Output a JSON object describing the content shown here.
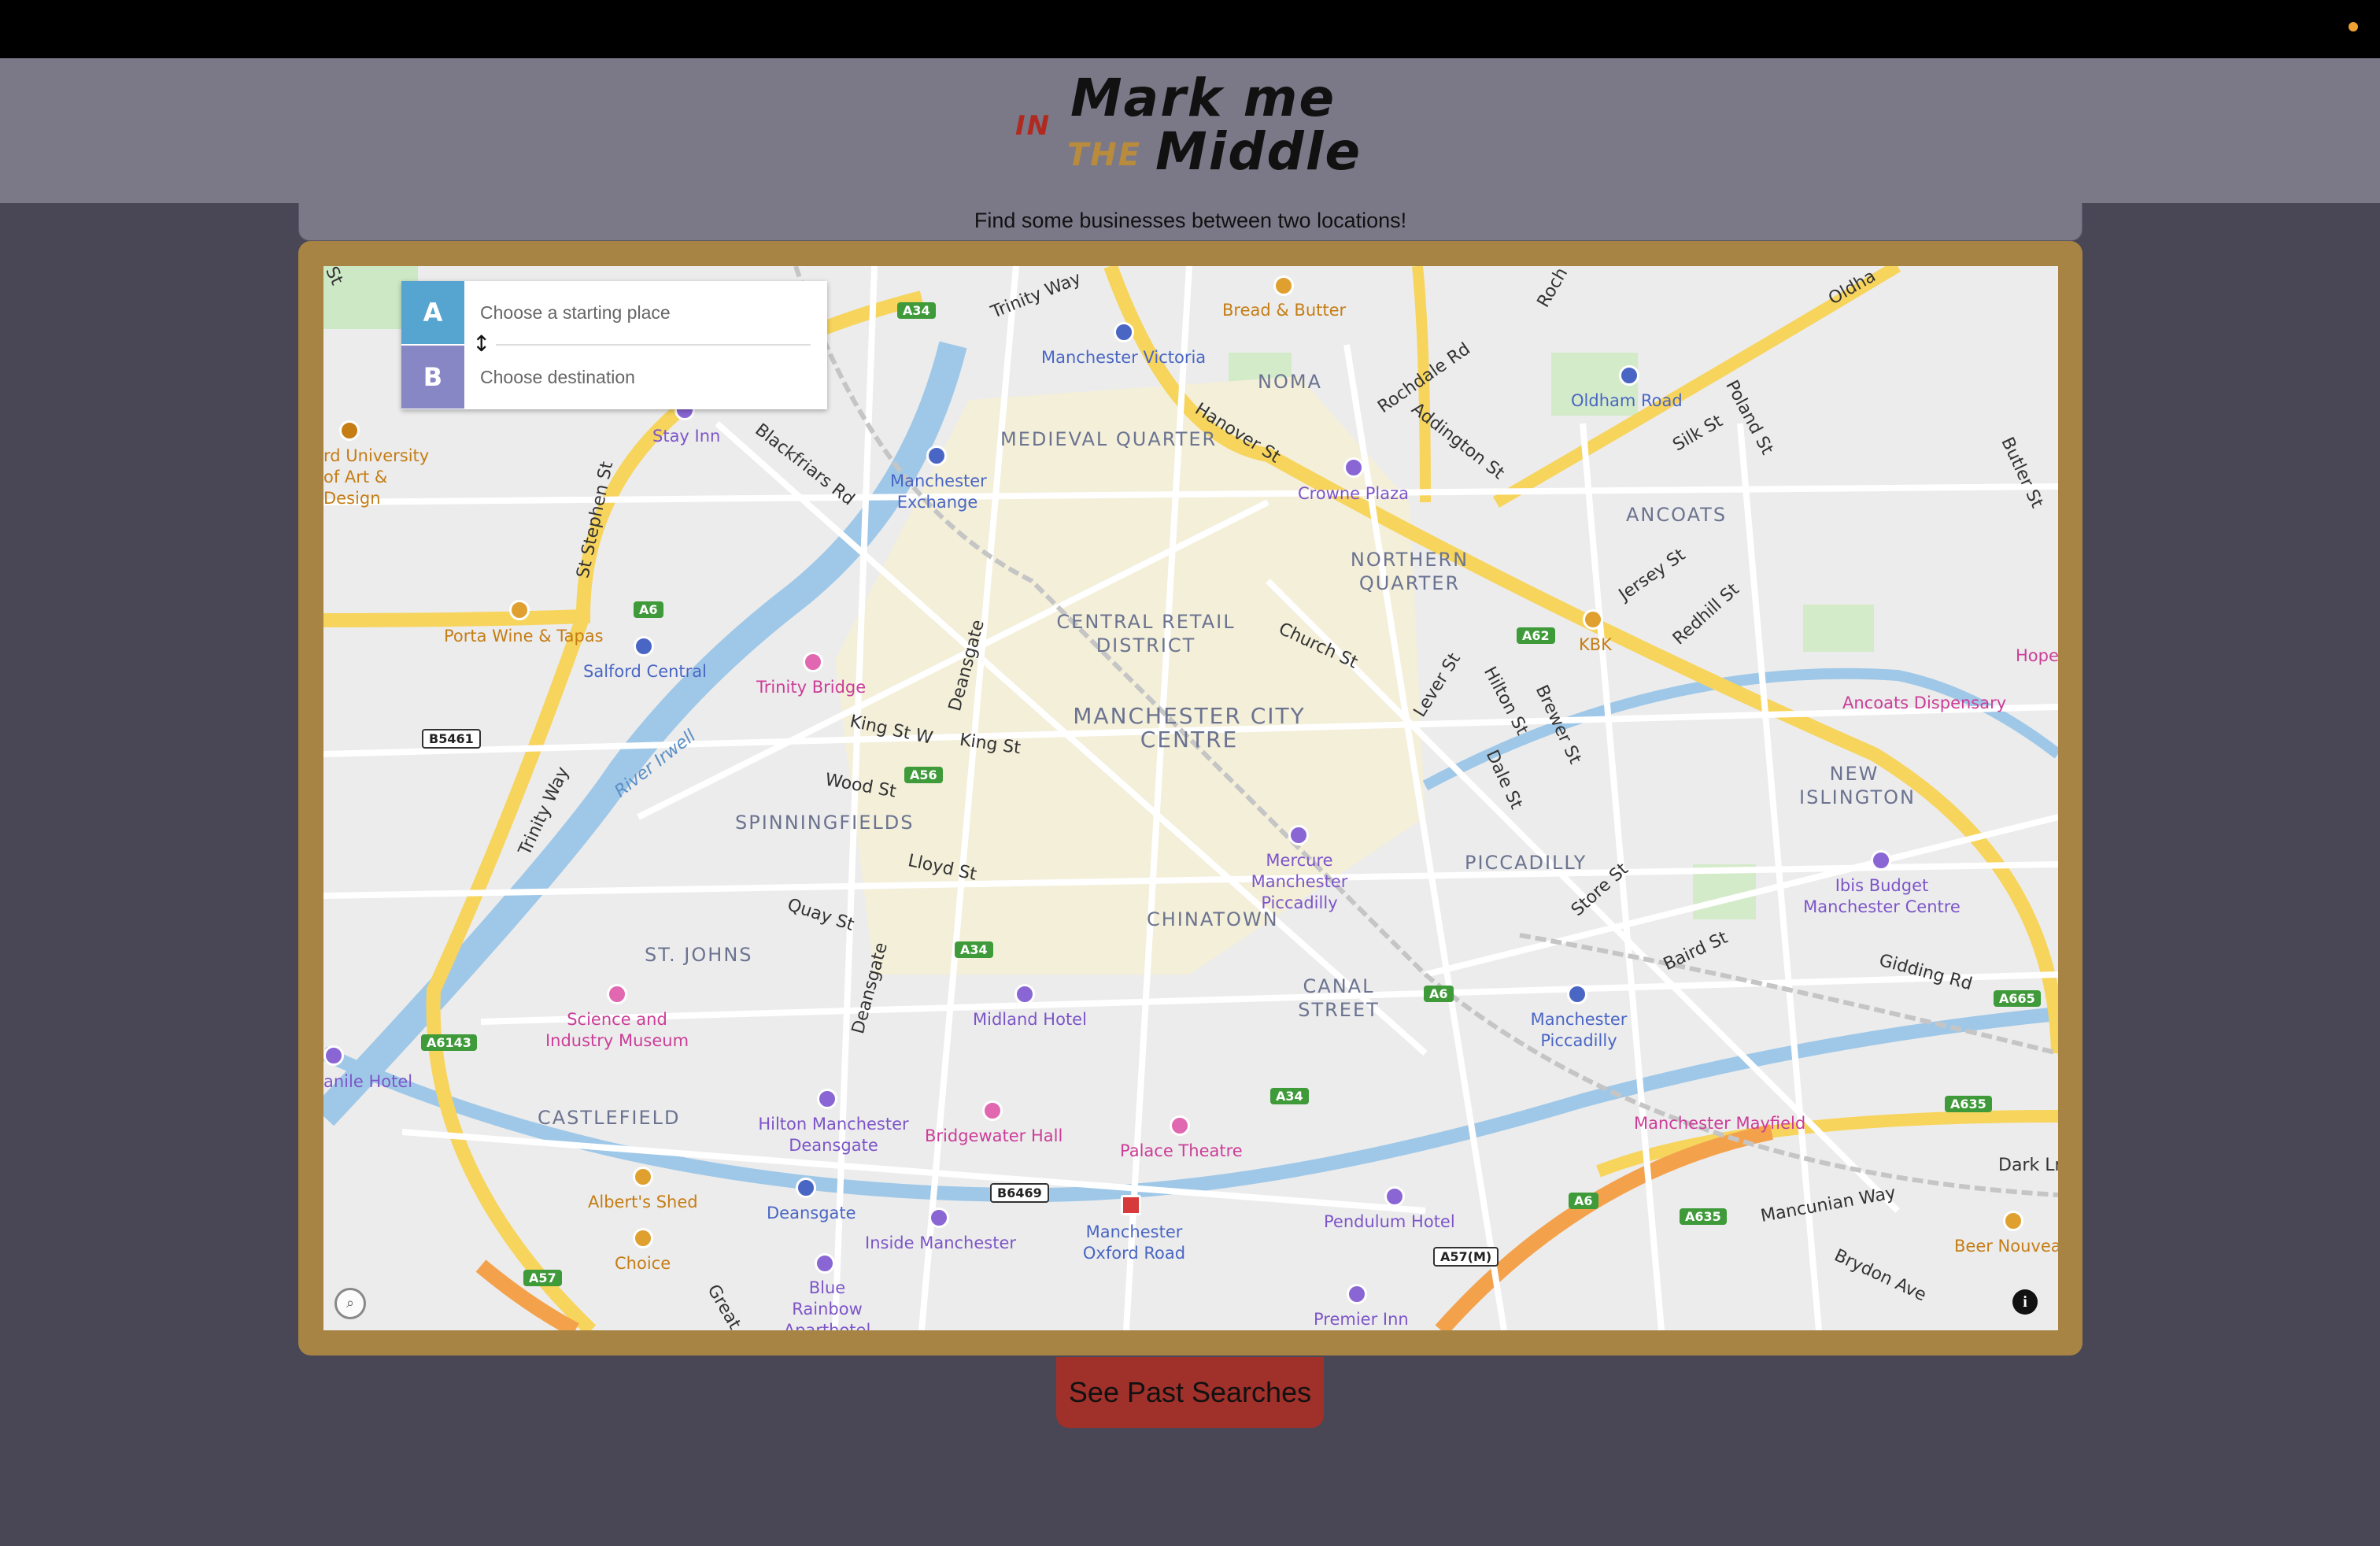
{
  "logo": {
    "in": "IN",
    "mark": "Mark me",
    "the": "THE",
    "middle": "Middle"
  },
  "subtitle": "Find some businesses between two locations!",
  "directions": {
    "a_letter": "A",
    "b_letter": "B",
    "start_placeholder": "Choose a starting place",
    "dest_placeholder": "Choose destination"
  },
  "map": {
    "districts": [
      "MEDIEVAL QUARTER",
      "CENTRAL RETAIL DISTRICT",
      "MANCHESTER CITY CENTRE",
      "NORTHERN QUARTER",
      "ANCOATS",
      "NEW ISLINGTON",
      "PICCADILLY",
      "CHINATOWN",
      "CANAL STREET",
      "SPINNINGFIELDS",
      "ST. JOHNS",
      "CASTLEFIELD",
      "NOMA"
    ],
    "pois": {
      "manchester_victoria": "Manchester Victoria",
      "bread_butter": "Bread & Butter",
      "oldham_road": "Oldham Road",
      "stay_inn": "Stay Inn",
      "university": "rd University of Art & Design",
      "manchester_exchange": "Manchester Exchange",
      "crowne_plaza": "Crowne Plaza",
      "porta": "Porta Wine & Tapas",
      "salford_central": "Salford Central",
      "trinity_bridge": "Trinity Bridge",
      "kbk": "KBK",
      "ancoats_dispensary": "Ancoats Dispensary",
      "mercure": "Mercure Manchester Piccadilly",
      "ibis": "Ibis Budget Manchester Centre",
      "science": "Science and Industry Museum",
      "midland": "Midland Hotel",
      "manchester_piccadilly": "Manchester Piccadilly",
      "hilton": "Hilton Manchester Deansgate",
      "bridgewater": "Bridgewater Hall",
      "palace": "Palace Theatre",
      "mayfield": "Manchester Mayfield",
      "alberts": "Albert's Shed",
      "deansgate": "Deansgate",
      "inside": "Inside Manchester",
      "oxford_road": "Manchester Oxford Road",
      "pendulum": "Pendulum Hotel",
      "beer": "Beer Nouvea",
      "choice": "Choice",
      "blue_rainbow": "Blue Rainbow Aparthotel",
      "premier": "Premier Inn",
      "danile": "anile Hotel",
      "hope": "Hope"
    },
    "streets": {
      "trinity_way": "Trinity Way",
      "trinity_way2": "Trinity Way",
      "rochdale": "Rochdale Rd",
      "addington": "Addington St",
      "hanover": "Hanover St",
      "blackfriars": "Blackfriars Rd",
      "st_stephen": "St Stephen St",
      "church": "Church St",
      "lever": "Lever St",
      "hilton_st": "Hilton St",
      "brewer": "Brewer St",
      "dale": "Dale St",
      "jersey": "Jersey St",
      "redhill": "Redhill St",
      "silk": "Silk St",
      "poland": "Poland St",
      "butler": "Butler St",
      "king_w": "King St W",
      "king": "King St",
      "wood": "Wood St",
      "deansgate1": "Deansgate",
      "deansgate2": "Deansgate",
      "lloyd": "Lloyd St",
      "quay": "Quay St",
      "store": "Store St",
      "baird": "Baird St",
      "gidding": "Gidding Rd",
      "mancunian": "Mancunian Way",
      "brydon": "Brydon Ave",
      "dark": "Dark Ln",
      "river": "River Irwell",
      "great": "Great",
      "oldham": "Oldha",
      "rochd": "Roch",
      "st": "St"
    },
    "shields": [
      "A34",
      "A6",
      "A62",
      "A56",
      "B5461",
      "A34",
      "A6",
      "A665",
      "A6143",
      "A34",
      "A635",
      "A6",
      "A635",
      "B6469",
      "A57(M)",
      "A57"
    ]
  },
  "past_searches_label": "See Past Searches",
  "colors": {
    "header": "#7b7888",
    "body": "#494656",
    "frame": "#a78444",
    "button": "#a0302a",
    "marker_a": "#55a5d0",
    "marker_b": "#8887c6"
  },
  "icons": {
    "swap": "swap-vertical-icon",
    "info": "info-icon",
    "mapbox": "mapbox-logo"
  }
}
